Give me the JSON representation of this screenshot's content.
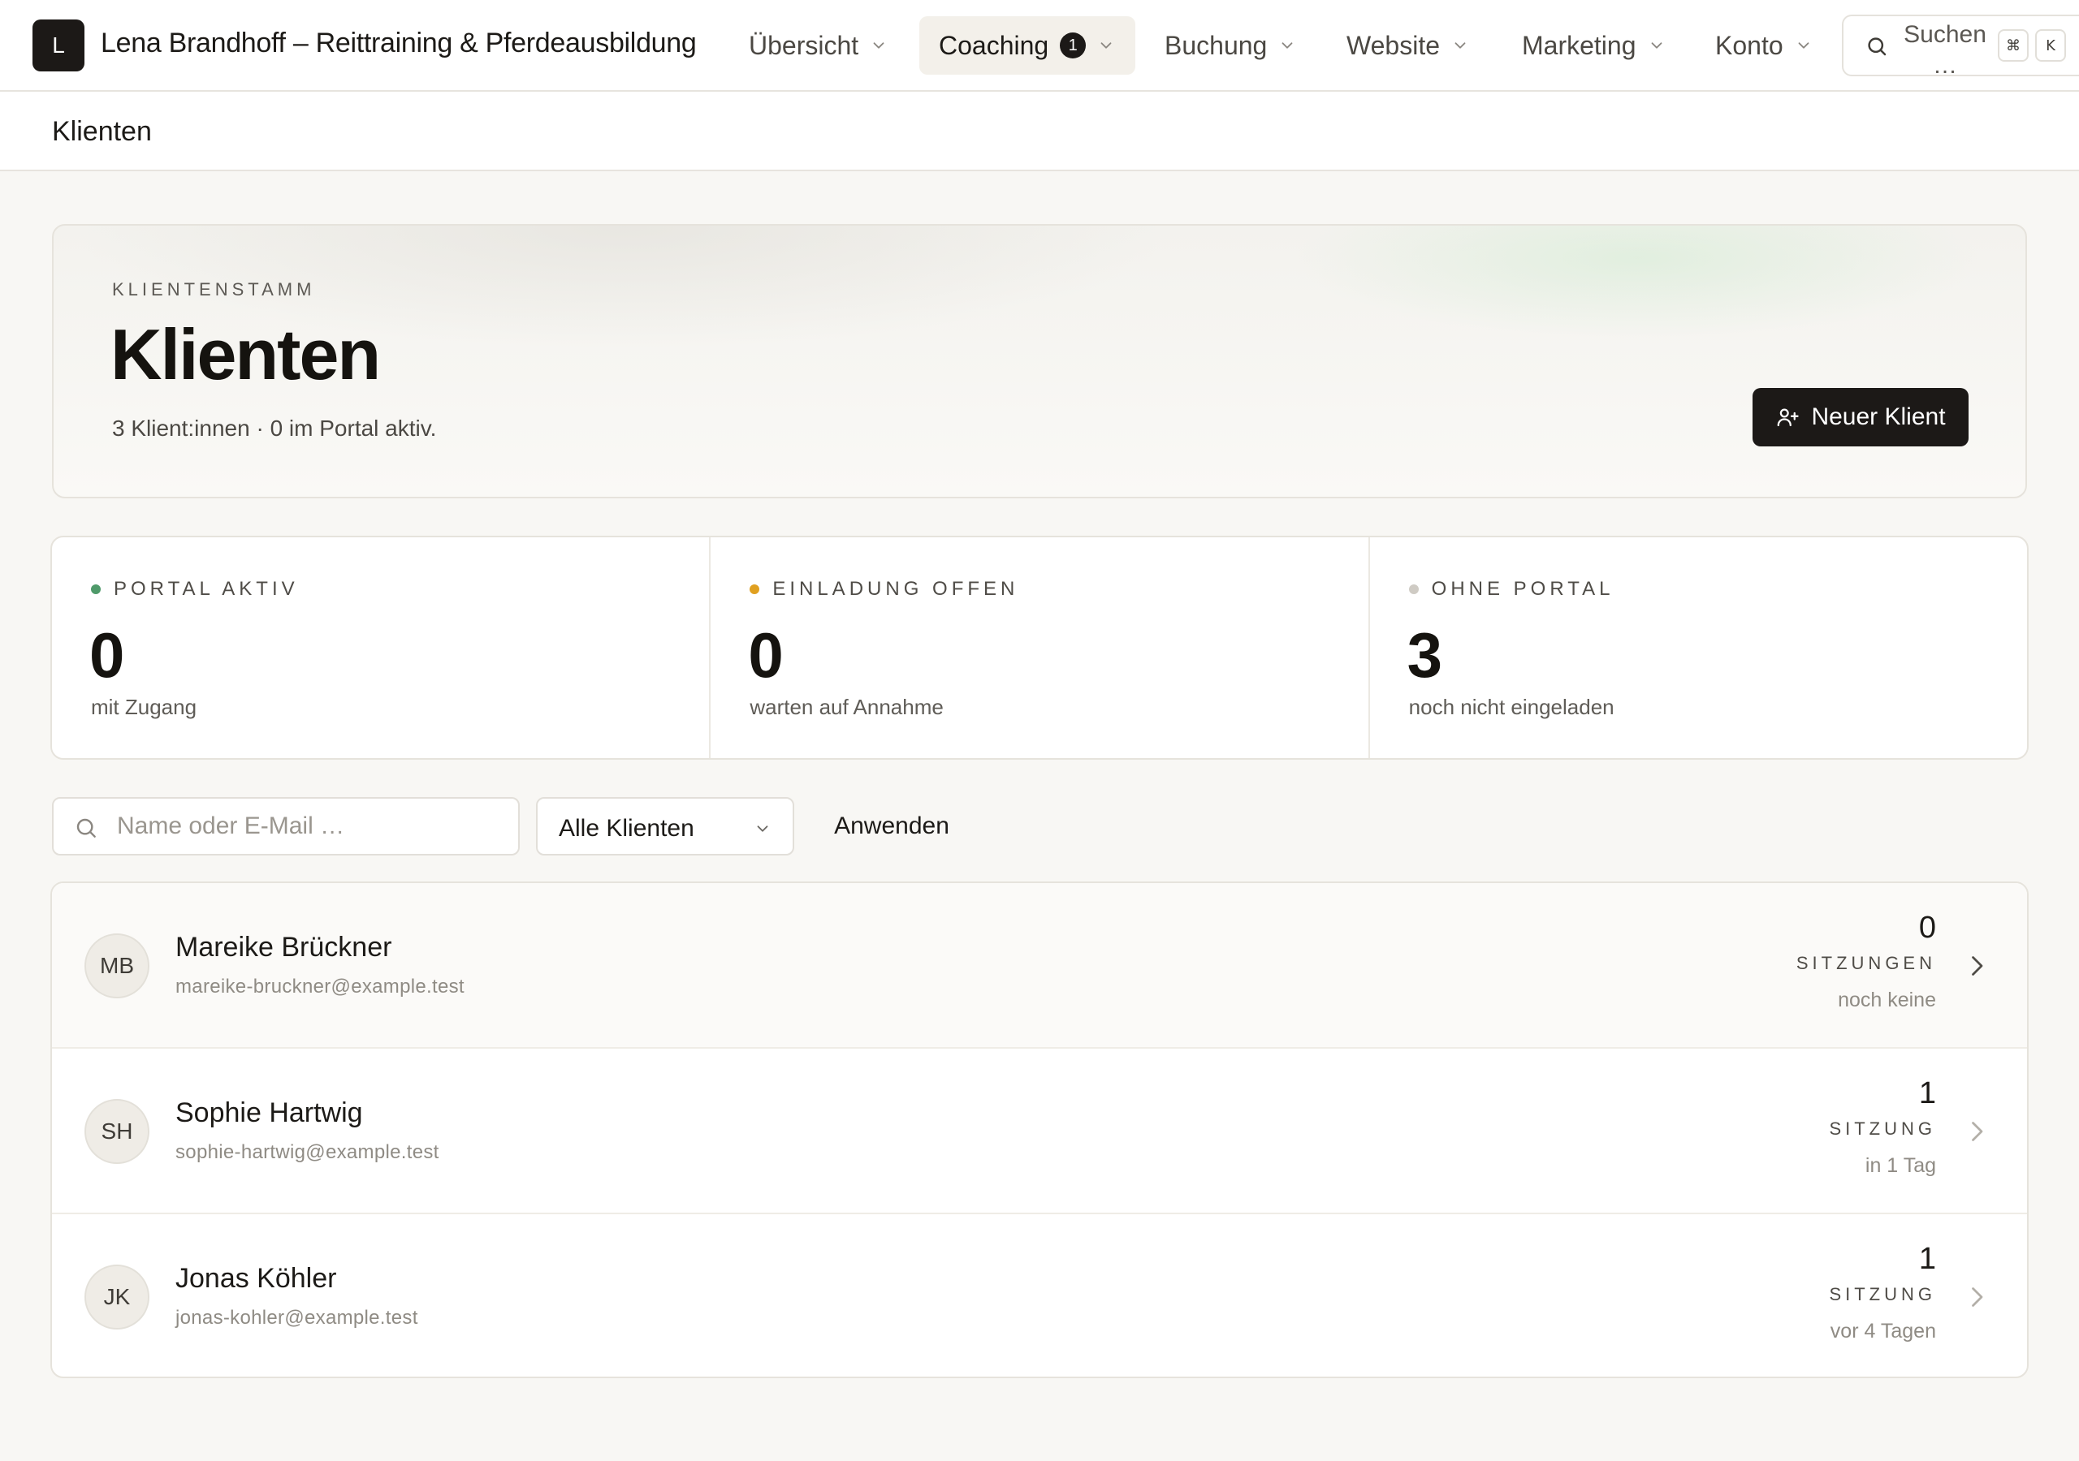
{
  "nav": {
    "logo_letter": "L",
    "brand": "Lena Brandhoff – Reittraining & Pferdeausbildung",
    "items": [
      {
        "label": "Übersicht",
        "active": false
      },
      {
        "label": "Coaching",
        "active": true,
        "badge": "1"
      },
      {
        "label": "Buchung",
        "active": false
      },
      {
        "label": "Website",
        "active": false
      },
      {
        "label": "Marketing",
        "active": false
      },
      {
        "label": "Konto",
        "active": false
      }
    ],
    "search": {
      "label": "Suchen …",
      "kbd_cmd": "⌘",
      "kbd_key": "K"
    }
  },
  "page": {
    "title": "Klienten"
  },
  "hero": {
    "eyebrow": "KLIENTENSTAMM",
    "title": "Klienten",
    "subtitle": "3 Klient:innen · 0 im Portal aktiv.",
    "new_client_label": "Neuer Klient"
  },
  "stats": [
    {
      "label": "PORTAL AKTIV",
      "value": "0",
      "hint": "mit Zugang",
      "dot_color": "#4f9a6a"
    },
    {
      "label": "EINLADUNG OFFEN",
      "value": "0",
      "hint": "warten auf Annahme",
      "dot_color": "#e0a020"
    },
    {
      "label": "OHNE PORTAL",
      "value": "3",
      "hint": "noch nicht eingeladen",
      "dot_color": "#cfcbc4"
    }
  ],
  "filter": {
    "search_placeholder": "Name oder E-Mail …",
    "search_value": "",
    "select_value": "Alle Klienten",
    "apply_label": "Anwenden"
  },
  "clients": [
    {
      "initials": "MB",
      "name": "Mareike Brückner",
      "email": "mareike-bruckner@example.test",
      "sessions": "0",
      "sessions_label": "SITZUNGEN",
      "when": "noch keine"
    },
    {
      "initials": "SH",
      "name": "Sophie Hartwig",
      "email": "sophie-hartwig@example.test",
      "sessions": "1",
      "sessions_label": "SITZUNG",
      "when": "in 1 Tag"
    },
    {
      "initials": "JK",
      "name": "Jonas Köhler",
      "email": "jonas-kohler@example.test",
      "sessions": "1",
      "sessions_label": "SITZUNG",
      "when": "vor 4 Tagen"
    }
  ],
  "colors": {
    "brand_dark": "#1c1917",
    "background": "#f8f7f4",
    "accent_green": "#4f9a6a",
    "accent_amber": "#e0a020"
  }
}
